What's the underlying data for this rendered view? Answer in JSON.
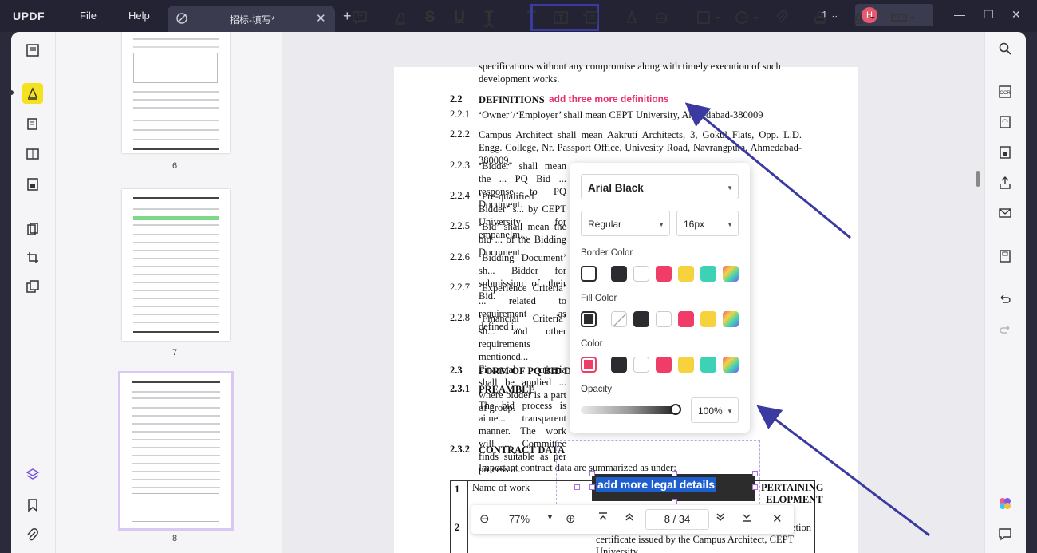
{
  "app": {
    "logo": "UPDF"
  },
  "menu": {
    "file": "File",
    "help": "Help"
  },
  "tab": {
    "title": "招标-填写*",
    "close": "✕",
    "add": "+"
  },
  "window": {
    "page_indicator": "1",
    "avatar_initial": "H"
  },
  "thumbnails": [
    {
      "label": "6"
    },
    {
      "label": "7"
    },
    {
      "label": "8"
    }
  ],
  "document": {
    "intro": "development works.",
    "intro_top": "specifications without any compromise along with timely execution of such",
    "sections": [
      {
        "num": "2.2",
        "text": "DEFINITIONS",
        "bold": true
      },
      {
        "num": "2.2.1",
        "text": "‘Owner’/‘Employer’ shall mean CEPT University, Ahmedabad-380009"
      },
      {
        "num": "2.2.2",
        "text": "Campus Architect shall mean Aakruti Architects, 3, Gokul Flats, Opp. L.D. Engg. College, Nr. Passport Office, Univesity Road, Navrangpura, Ahmedabad-380009."
      },
      {
        "num": "2.2.3",
        "text": "‘Bidder’ shall mean the ... PQ Bid ... response to PQ Document."
      },
      {
        "num": "2.2.4",
        "text": "‘Pre-qualified Bidder’ s... by CEPT University for empanelm..."
      },
      {
        "num": "2.2.5",
        "text": "‘Bid’ shall mean the bid ... of the Bidding Document."
      },
      {
        "num": "2.2.6",
        "text": "‘Bidding Document’ sh... Bidder for submission of their Bid."
      },
      {
        "num": "2.2.7",
        "text": "‘Experience Criteria’ ... related to requirement as defined i..."
      },
      {
        "num": "2.2.8",
        "text": "‘Financial Criteria’ sh... and other requirements mentioned... Financial criteria shall be applied ... where bidder is a part of group."
      },
      {
        "num": "2.3",
        "text": "FORM OF PQ BID DO...",
        "bold": true
      },
      {
        "num": "2.3.1",
        "text": "PREAMBLE",
        "bold": true
      },
      {
        "num": "",
        "text": "The bid process is aime... transparent manner. The work will ... Committee finds suitable as per process a..."
      },
      {
        "num": "2.3.2",
        "text": "CONTRACT DATA",
        "bold": true
      },
      {
        "num": "",
        "text": "Important contract data are summarized as under:"
      }
    ],
    "table_row1_num": "1",
    "table_row1_label": "Name of work",
    "table_row1_right": "PERTAINING",
    "table_row1_right2": "ELOPMENT",
    "table_row2_num": "2",
    "table_row2_right1": "etion",
    "table_row2_right2": "certificate issued by the Campus Architect, CEPT",
    "table_row2_right3": "University"
  },
  "annotations": {
    "definitions_note": "add three more definitions",
    "textbox": "add more legal details"
  },
  "popup": {
    "font": "Arial Black",
    "weight": "Regular",
    "size": "16px",
    "border_color_label": "Border Color",
    "fill_color_label": "Fill Color",
    "color_label": "Color",
    "opacity_label": "Opacity",
    "opacity_value": "100%"
  },
  "swatches": [
    "#ffffff",
    "#2b2b30",
    "#ffffff",
    "#f03d67",
    "#f6d33c",
    "#3dd2b6"
  ],
  "zoom": {
    "value": "77%",
    "page": "8",
    "sep": "/",
    "total": "34"
  }
}
